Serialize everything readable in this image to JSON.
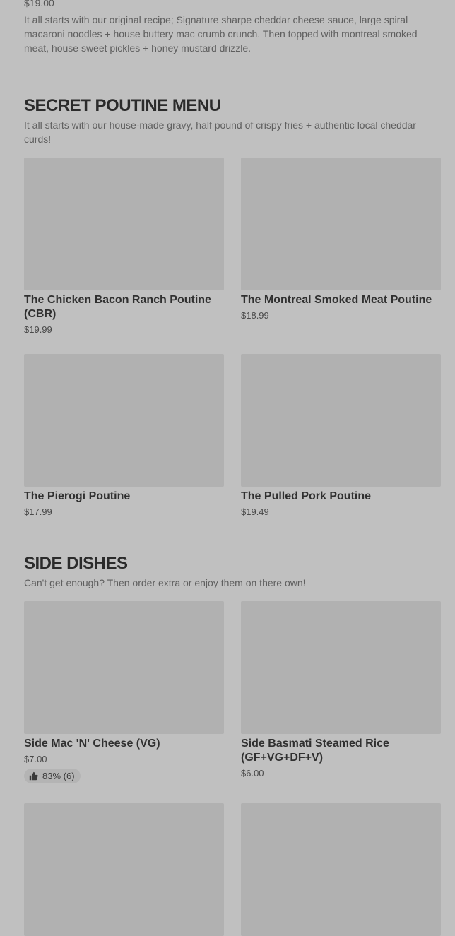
{
  "top_item": {
    "price": "$19.00",
    "description": "It all starts with our original recipe; Signature sharpe cheddar cheese sauce, large spiral macaroni noodles + house buttery mac crumb crunch. Then topped with montreal smoked meat, house sweet pickles + honey mustard drizzle."
  },
  "sections": [
    {
      "title": "SECRET POUTINE MENU",
      "description": "It all starts with our house-made gravy, half pound of crispy fries + authentic local cheddar curds!",
      "items": [
        {
          "name": "The Chicken Bacon Ranch Poutine (CBR)",
          "price": "$19.99"
        },
        {
          "name": "The Montreal Smoked Meat Poutine",
          "price": "$18.99"
        },
        {
          "name": "The Pierogi Poutine",
          "price": "$17.99"
        },
        {
          "name": "The Pulled Pork Poutine",
          "price": "$19.49"
        }
      ]
    },
    {
      "title": "SIDE DISHES",
      "description": "Can't get enough? Then order extra or enjoy them on there own!",
      "items": [
        {
          "name": "Side Mac 'N' Cheese (VG)",
          "price": "$7.00",
          "rating": "83% (6)"
        },
        {
          "name": "Side Basmati Steamed Rice (GF+VG+DF+V)",
          "price": "$6.00"
        }
      ]
    }
  ]
}
